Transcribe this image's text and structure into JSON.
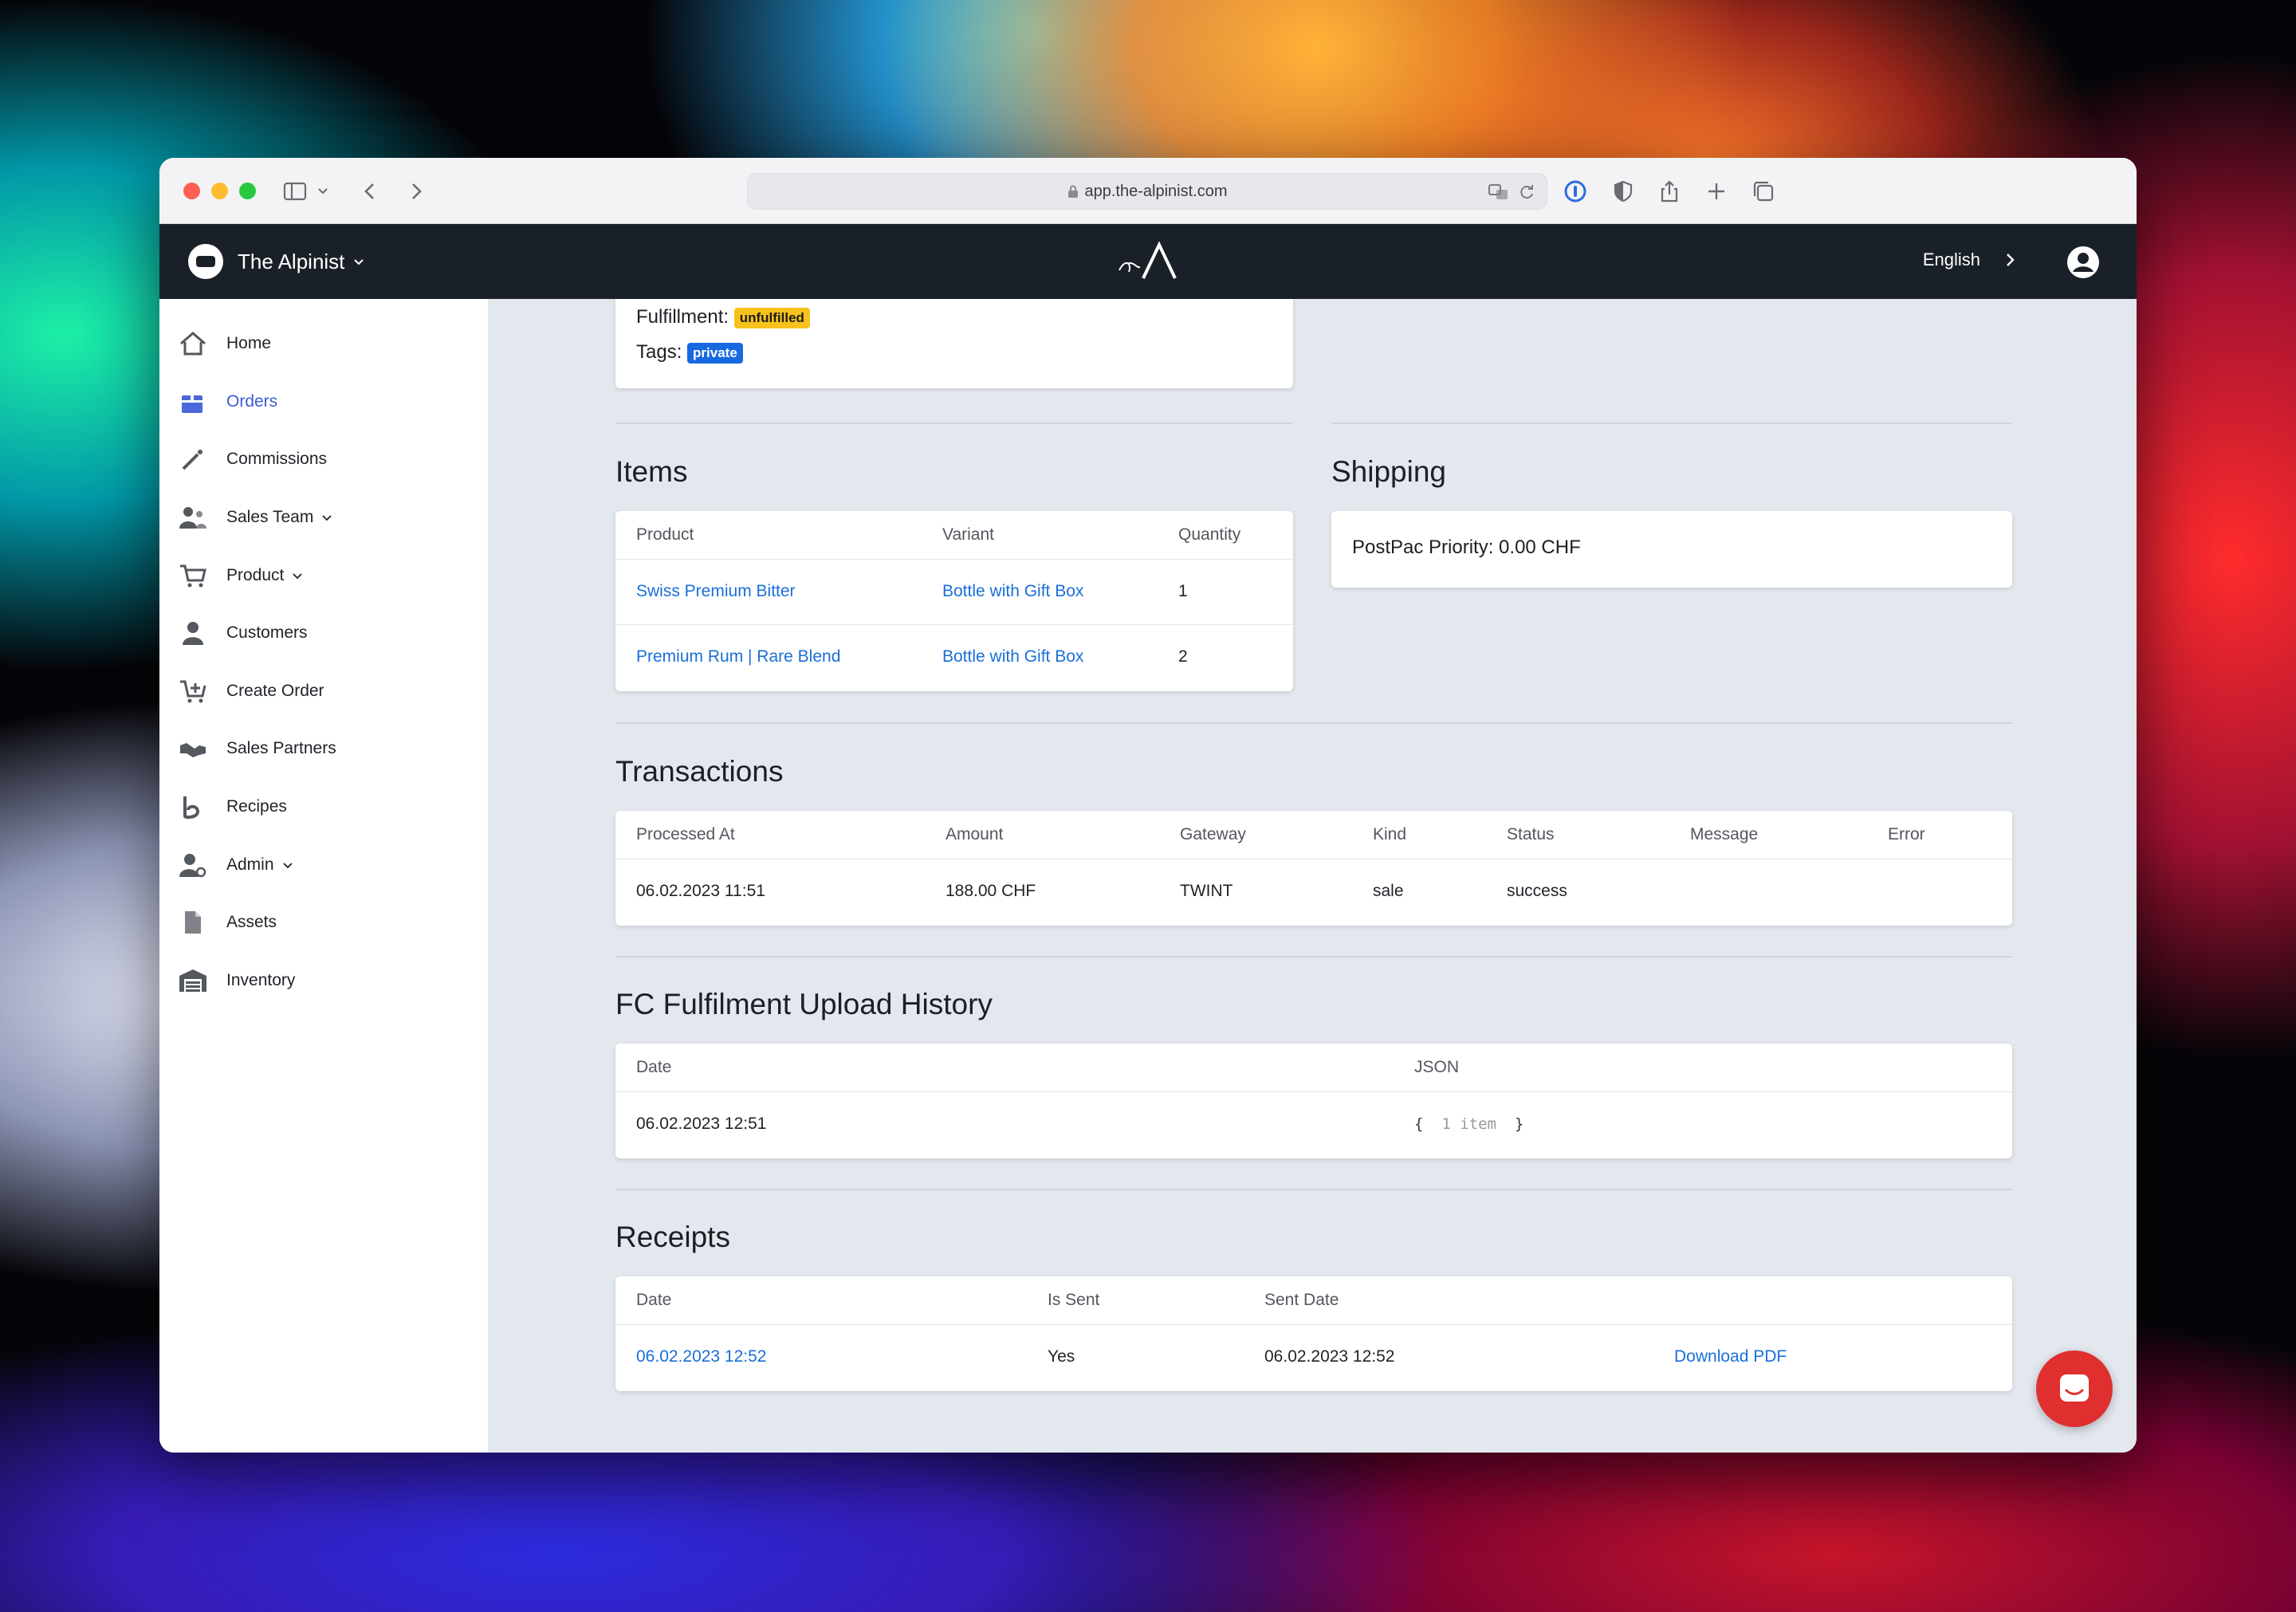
{
  "browser": {
    "url": "app.the-alpinist.com"
  },
  "navbar": {
    "brand": "The Alpinist",
    "language": "English"
  },
  "sidebar": {
    "items": [
      {
        "label": "Home",
        "icon": "home-icon"
      },
      {
        "label": "Orders",
        "icon": "orders-icon",
        "active": true
      },
      {
        "label": "Commissions",
        "icon": "commissions-icon"
      },
      {
        "label": "Sales Team",
        "icon": "sales-team-icon",
        "expandable": true
      },
      {
        "label": "Product",
        "icon": "cart-icon",
        "expandable": true
      },
      {
        "label": "Customers",
        "icon": "customers-icon"
      },
      {
        "label": "Create Order",
        "icon": "cart-plus-icon"
      },
      {
        "label": "Sales Partners",
        "icon": "handshake-icon"
      },
      {
        "label": "Recipes",
        "icon": "recipes-icon"
      },
      {
        "label": "Admin",
        "icon": "admin-icon",
        "expandable": true
      },
      {
        "label": "Assets",
        "icon": "file-icon"
      },
      {
        "label": "Inventory",
        "icon": "warehouse-icon"
      }
    ]
  },
  "summary": {
    "fulfillment_label": "Fulfillment:",
    "fulfillment_badge": "unfulfilled",
    "tags_label": "Tags:",
    "tags_badge": "private"
  },
  "items": {
    "title": "Items",
    "headers": [
      "Product",
      "Variant",
      "Quantity"
    ],
    "rows": [
      {
        "product": "Swiss Premium Bitter",
        "variant": "Bottle with Gift Box",
        "quantity": "1"
      },
      {
        "product": "Premium Rum | Rare Blend",
        "variant": "Bottle with Gift Box",
        "quantity": "2"
      }
    ]
  },
  "shipping": {
    "title": "Shipping",
    "text": "PostPac Priority: 0.00 CHF"
  },
  "transactions": {
    "title": "Transactions",
    "headers": [
      "Processed At",
      "Amount",
      "Gateway",
      "Kind",
      "Status",
      "Message",
      "Error"
    ],
    "rows": [
      {
        "processed_at": "06.02.2023 11:51",
        "amount": "188.00 CHF",
        "gateway": "TWINT",
        "kind": "sale",
        "status": "success",
        "message": "",
        "error": ""
      }
    ]
  },
  "fc_history": {
    "title": "FC Fulfilment Upload History",
    "headers": [
      "Date",
      "JSON"
    ],
    "rows": [
      {
        "date": "06.02.2023 12:51",
        "json_open": "{",
        "json_summary": "1 item",
        "json_close": "}"
      }
    ]
  },
  "receipts": {
    "title": "Receipts",
    "headers": [
      "Date",
      "Is Sent",
      "Sent Date",
      ""
    ],
    "rows": [
      {
        "date": "06.02.2023 12:52",
        "is_sent": "Yes",
        "sent_date": "06.02.2023 12:52",
        "action": "Download PDF"
      }
    ]
  },
  "colors": {
    "navbar_bg": "#1a2027",
    "accent": "#1a6fd8",
    "active_nav": "#3b5bd6",
    "badge_warning": "#f7c21b",
    "badge_primary": "#1769e0",
    "chat_button": "#e02f2f"
  }
}
